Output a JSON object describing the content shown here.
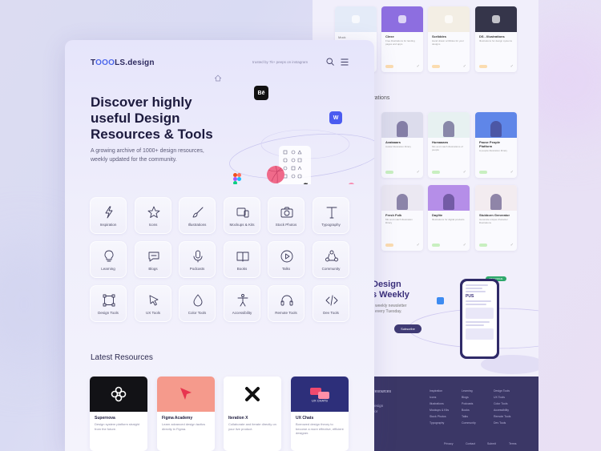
{
  "colors": {
    "accent": "#4d67ec",
    "dark_navy": "#3b3766",
    "tag_green": "#c8efc0",
    "tag_orange": "#fbdcb0"
  },
  "back": {
    "top_cards": [
      {
        "title": "",
        "desc": "",
        "thumb": "#e4ebf8",
        "tag": "#c8efc0",
        "icon": "mail-icon"
      },
      {
        "title": "Clexe",
        "desc": "Free illustrations for landing pages and apps",
        "thumb": "#8d6ee0",
        "tag": "#fbdcb0",
        "icon": "shape-icon"
      },
      {
        "title": "Scribbles",
        "desc": "Hand drawn scribbles for your designs",
        "thumb": "#f3eee4",
        "tag": "#fbdcb0",
        "icon": "scribble-icon"
      },
      {
        "title": "DS - Illustrations",
        "desc": "Illustrations for design systems",
        "thumb": "#35354a",
        "tag": "#fbdcb0",
        "icon": "ds-icon"
      }
    ],
    "mail_label": "Mock",
    "section_label": "ustrations",
    "mid_cards": [
      {
        "title": "Avataaars",
        "desc": "Avatar illustration library",
        "thumb": "#dcdcec",
        "tag": "#c8efc0"
      },
      {
        "title": "Humaaans",
        "desc": "Mix and match illustrations of people",
        "thumb": "#e7f1f1",
        "tag": "#c8efc0"
      },
      {
        "title": "Pause People Platform",
        "desc": "A people illustration library",
        "thumb": "#5f86e8",
        "tag": "#c8efc0"
      },
      {
        "title": "Fresh Folk",
        "desc": "Mix and match illustration library",
        "thumb": "#ebe8f2",
        "tag": "#fbdcb0"
      },
      {
        "title": "Daylite",
        "desc": "Illustrations for digital products",
        "thumb": "#b58ee8",
        "tag": "#c8efc0"
      },
      {
        "title": "Stubborn Generator",
        "desc": "Generate unique character illustrations",
        "thumb": "#f3ecf0",
        "tag": "#c8efc0"
      }
    ],
    "promo_title_1": "Design",
    "promo_title_2": "s Weekly",
    "promo_sub_1": "weekly newsletter",
    "promo_sub_2": "every Tuesday.",
    "subscribe": "Subscribe",
    "phone_badge": "NEW ISSUE",
    "phone_headline": "PUS",
    "footer": {
      "title": "ign Resources",
      "sub1": "00+ design",
      "sub2": "ated for",
      "col1": [
        "Inspiration",
        "Icons",
        "Illustrations",
        "Mockups & Kits",
        "Stock Photos",
        "Typography"
      ],
      "col2": [
        "Learning",
        "Blogs",
        "Podcasts",
        "Books",
        "Talks",
        "Community"
      ],
      "col3": [
        "Design Tools",
        "UX Tools",
        "Color Tools",
        "Accessibility",
        "Remote Tools",
        "Dev Tools"
      ],
      "bottom": [
        "Privacy",
        "Contact",
        "Submit",
        "Terms"
      ]
    }
  },
  "header": {
    "logo_pre": "T",
    "logo_oo": "OOO",
    "logo_post": "LS.design",
    "trusted": "trusted by 7k+ peeps on instagram"
  },
  "hero": {
    "title_1": "Discover highly",
    "title_2": "useful Design",
    "title_3": "Resources & Tools",
    "subtitle": "A growing archive of 1000+ design resources, weekly updated for the community."
  },
  "categories": [
    {
      "label": "Inspiration",
      "icon": "lightning-icon"
    },
    {
      "label": "Icons",
      "icon": "star-icon"
    },
    {
      "label": "Illustrations",
      "icon": "brush-icon"
    },
    {
      "label": "Mockups & Kits",
      "icon": "devices-icon"
    },
    {
      "label": "Stock Photos",
      "icon": "camera-icon"
    },
    {
      "label": "Typography",
      "icon": "type-icon"
    },
    {
      "label": "Learning",
      "icon": "bulb-icon"
    },
    {
      "label": "Blogs",
      "icon": "chat-icon"
    },
    {
      "label": "Podcasts",
      "icon": "mic-icon"
    },
    {
      "label": "Books",
      "icon": "book-icon"
    },
    {
      "label": "Talks",
      "icon": "play-icon"
    },
    {
      "label": "Community",
      "icon": "community-icon"
    },
    {
      "label": "Design Tools",
      "icon": "vector-icon"
    },
    {
      "label": "UX Tools",
      "icon": "cursor-icon"
    },
    {
      "label": "Color Tools",
      "icon": "drop-icon"
    },
    {
      "label": "Accessibility",
      "icon": "accessibility-icon"
    },
    {
      "label": "Remote Tools",
      "icon": "headset-icon"
    },
    {
      "label": "Dev Tools",
      "icon": "code-icon"
    }
  ],
  "latest": {
    "title": "Latest Resources",
    "cards": [
      {
        "title": "Supernova",
        "desc": "Design system platform straight from the future.",
        "thumb": "#121216"
      },
      {
        "title": "Figma Academy",
        "desc": "Learn advanced design tactics directly in Figma.",
        "thumb": "#f59a8c"
      },
      {
        "title": "Iteration X",
        "desc": "Collaborate and iterate directly on your live product.",
        "thumb": "#ffffff"
      },
      {
        "title": "UX Chats",
        "desc": "Borrowed design theory to become a more effective, efficient designer.",
        "thumb": "#2d2f7a"
      }
    ]
  },
  "orbit_badges": {
    "behance": "Bē",
    "webflow": "W"
  }
}
